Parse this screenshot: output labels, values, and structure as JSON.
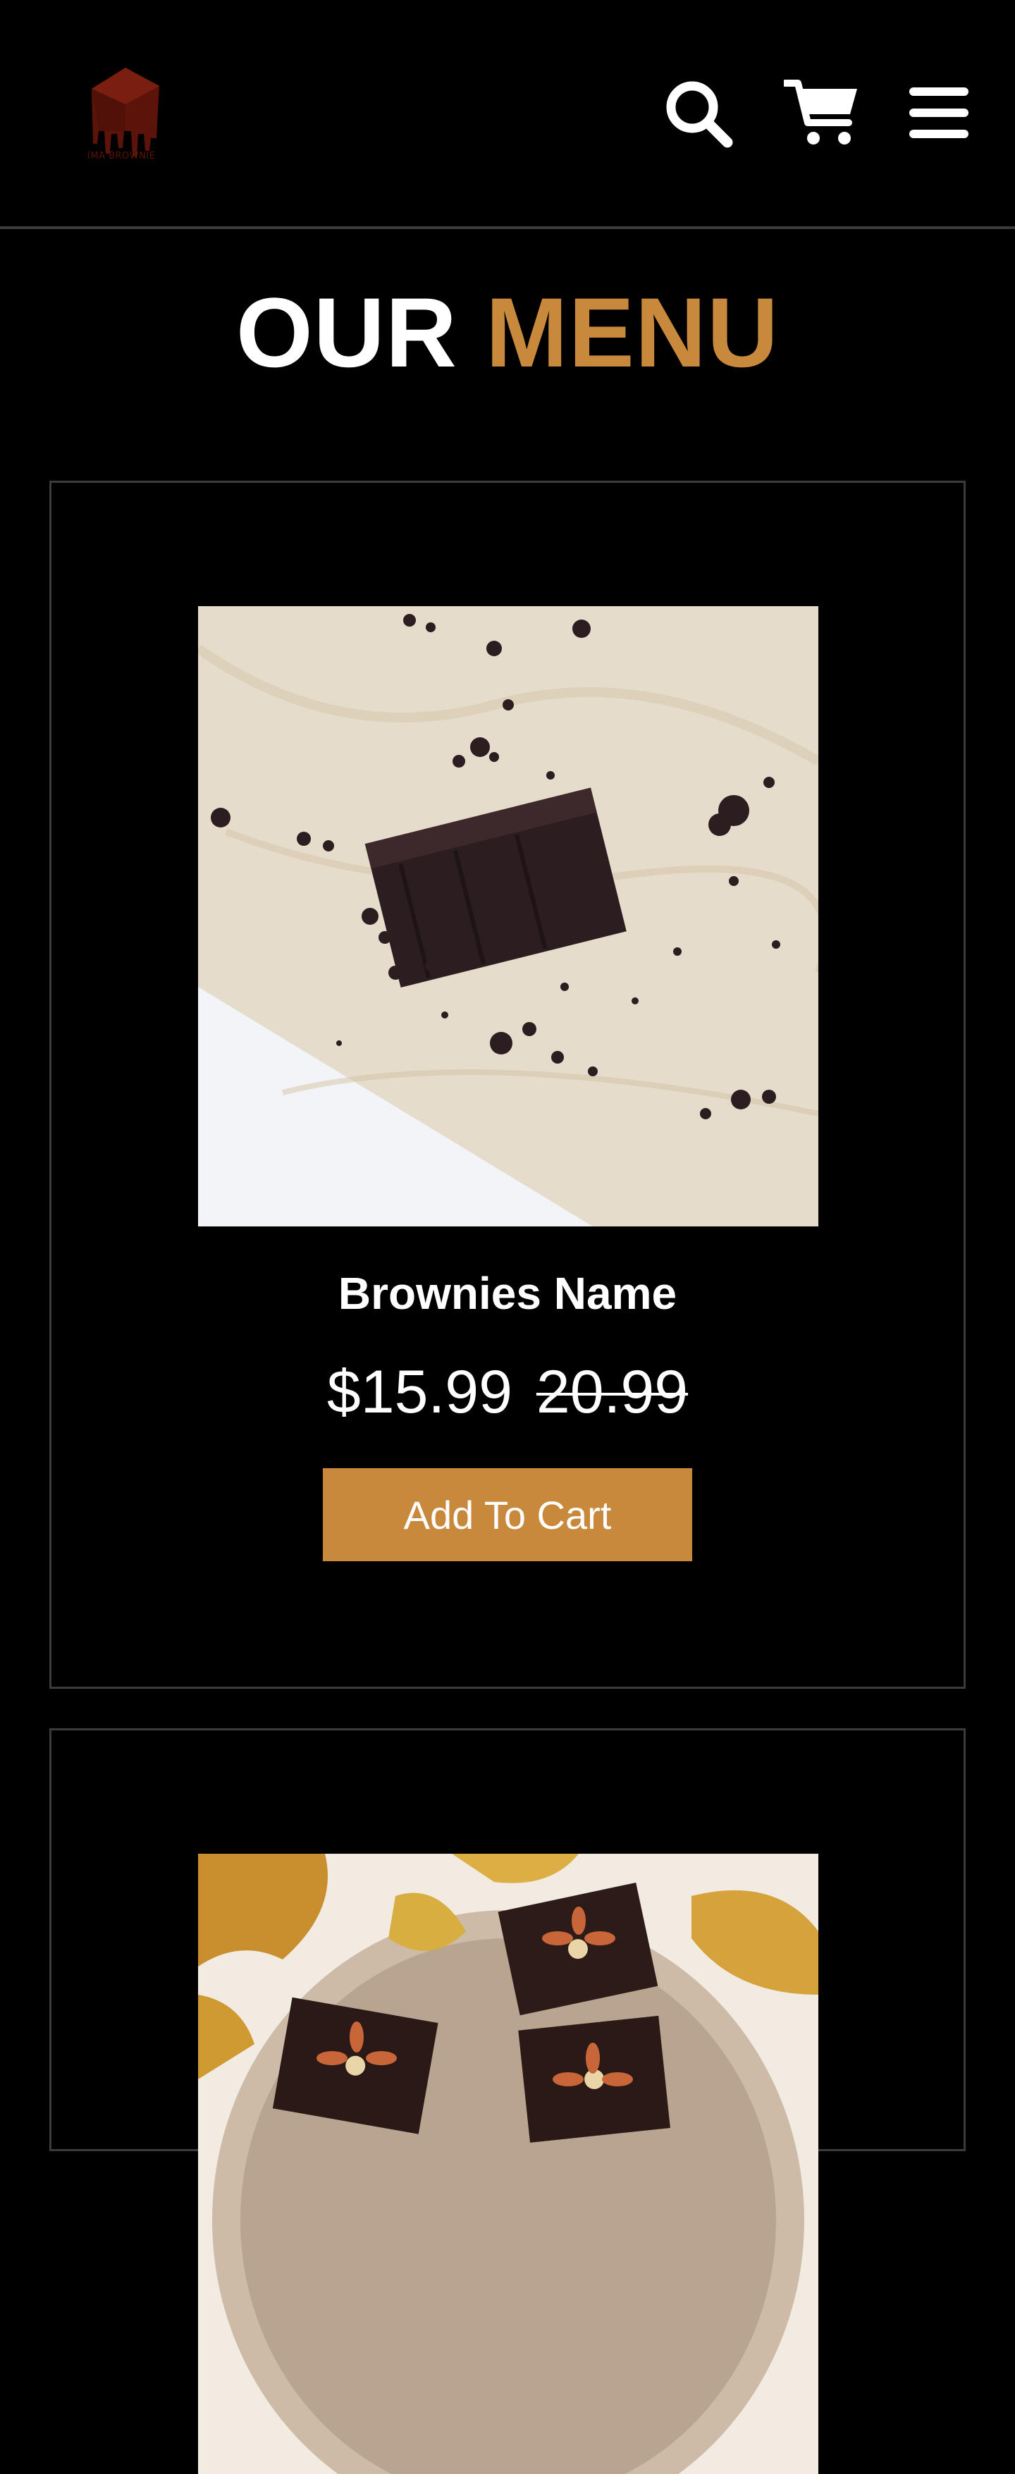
{
  "header": {
    "logo_text": "IMA BROWNIE",
    "icons": [
      "search-icon",
      "cart-icon",
      "hamburger-menu-icon"
    ]
  },
  "menu": {
    "title_part1": "OUR",
    "title_part2": "MENU",
    "items": [
      {
        "name": "Brownies Name",
        "price": "$15.99",
        "old_price": "20.99",
        "button_label": "Add To Cart"
      }
    ]
  },
  "colors": {
    "background": "#000000",
    "accent": "#c8893c",
    "border": "#3b3b3b",
    "text": "#ffffff"
  }
}
